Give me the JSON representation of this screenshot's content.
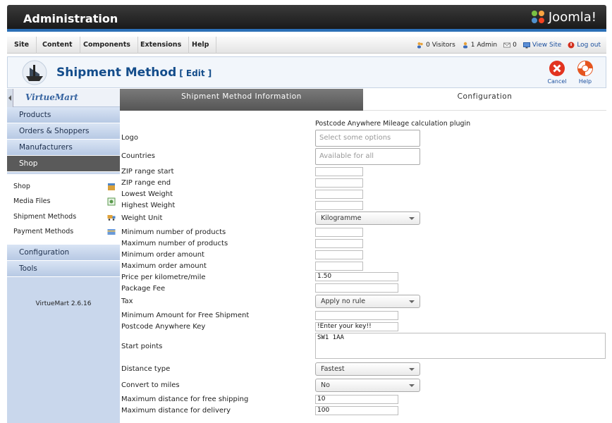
{
  "header": {
    "title": "Administration",
    "brand": "Joomla!",
    "brand_colors": [
      "#7ac143",
      "#f9a541",
      "#f44321",
      "#5091cd"
    ]
  },
  "menu": {
    "items": [
      "Site",
      "Content",
      "Components",
      "Extensions",
      "Help"
    ]
  },
  "status": {
    "visitors": "0 Visitors",
    "admins": "1 Admin",
    "messages": "0",
    "view_site": "View Site",
    "logout": "Log out"
  },
  "toolbar": {
    "title": "Shipment Method",
    "subtitle": "[ Edit ]",
    "cancel_label": "Cancel",
    "help_label": "Help"
  },
  "sidebar": {
    "logo_text": "VirtueMart",
    "sections": [
      {
        "label": "Products"
      },
      {
        "label": "Orders & Shoppers"
      },
      {
        "label": "Manufacturers"
      },
      {
        "label": "Shop"
      }
    ],
    "shop_items": [
      {
        "label": "Shop",
        "icon": "shop-icon"
      },
      {
        "label": "Media Files",
        "icon": "media-icon"
      },
      {
        "label": "Shipment Methods",
        "icon": "truck-icon"
      },
      {
        "label": "Payment Methods",
        "icon": "payment-icon"
      }
    ],
    "sections_bottom": [
      {
        "label": "Configuration"
      },
      {
        "label": "Tools"
      }
    ],
    "version": "VirtueMart 2.6.16"
  },
  "tabs": {
    "info": "Shipment Method Information",
    "config": "Configuration",
    "active": "config"
  },
  "form": {
    "plugin_name": "Postcode Anywhere Mileage calculation plugin",
    "labels": {
      "logo": "Logo",
      "countries": "Countries",
      "zip_start": "ZIP range start",
      "zip_end": "ZIP range end",
      "lowest_weight": "Lowest Weight",
      "highest_weight": "Highest Weight",
      "weight_unit": "Weight Unit",
      "min_products": "Minimum number of products",
      "max_products": "Maximum number of products",
      "min_order": "Minimum order amount",
      "max_order": "Maximum order amount",
      "price_per_km": "Price per kilometre/mile",
      "package_fee": "Package Fee",
      "tax": "Tax",
      "min_free": "Minimum Amount for Free Shipment",
      "pa_key": "Postcode Anywhere Key",
      "start_points": "Start points",
      "distance_type": "Distance type",
      "convert_miles": "Convert to miles",
      "max_free_dist": "Maximum distance for free shipping",
      "max_delivery_dist": "Maximum distance for delivery"
    },
    "values": {
      "logo_placeholder": "Select some options",
      "countries_placeholder": "Available for all",
      "weight_unit": "Kilogramme",
      "price_per_km": "1.50",
      "tax": "Apply no rule",
      "pa_key": "!Enter your key!!",
      "start_points": "SW1 1AA",
      "distance_type": "Fastest",
      "convert_miles": "No",
      "max_free_dist": "10",
      "max_delivery_dist": "100"
    }
  }
}
